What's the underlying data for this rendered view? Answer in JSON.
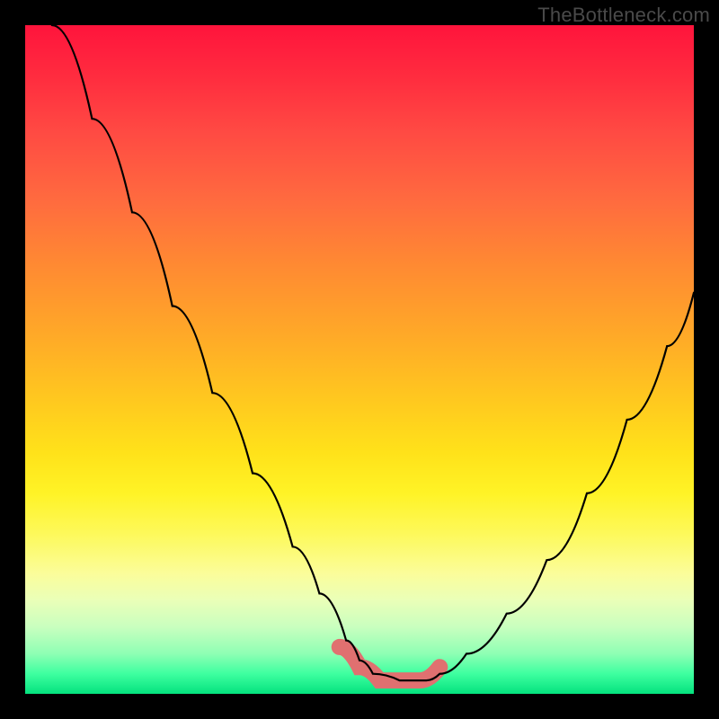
{
  "watermark": "TheBottleneck.com",
  "colors": {
    "curve": "#000000",
    "highlight": "#e07070",
    "background": "#000000"
  },
  "chart_data": {
    "type": "line",
    "title": "",
    "xlabel": "",
    "ylabel": "",
    "xlim": [
      0,
      100
    ],
    "ylim": [
      0,
      100
    ],
    "grid": false,
    "legend": false,
    "series": [
      {
        "name": "curve",
        "x": [
          4,
          10,
          16,
          22,
          28,
          34,
          40,
          44,
          48,
          50,
          52,
          56,
          60,
          62,
          66,
          72,
          78,
          84,
          90,
          96,
          100
        ],
        "values": [
          100,
          86,
          72,
          58,
          45,
          33,
          22,
          15,
          8,
          5,
          3,
          2,
          2,
          3,
          6,
          12,
          20,
          30,
          41,
          52,
          60
        ]
      },
      {
        "name": "highlight",
        "x": [
          47,
          50,
          53,
          56,
          59,
          62
        ],
        "values": [
          7,
          4,
          2,
          2,
          2,
          4
        ]
      }
    ],
    "gradient_stops": [
      {
        "pos": 0,
        "color": "#ff143c"
      },
      {
        "pos": 36,
        "color": "#ff8a32"
      },
      {
        "pos": 64,
        "color": "#ffe21a"
      },
      {
        "pos": 90,
        "color": "#c9ffbf"
      },
      {
        "pos": 100,
        "color": "#04e27e"
      }
    ]
  }
}
